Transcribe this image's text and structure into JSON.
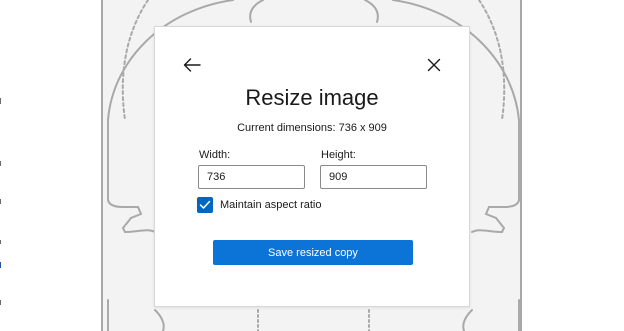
{
  "dialog": {
    "title": "Resize image",
    "current_dimensions": "Current dimensions: 736 x 909",
    "width_label": "Width:",
    "width_value": "736",
    "height_label": "Height:",
    "height_value": "909",
    "maintain_aspect_label": "Maintain aspect ratio",
    "maintain_aspect_checked": true,
    "save_label": "Save resized copy",
    "back_icon": "arrow-left-icon",
    "close_icon": "close-icon"
  },
  "colors": {
    "accent": "#0067c0",
    "primary_button": "#0b74d6",
    "canvas_background": "#f3f3f3",
    "sketch_stroke": "#a9a9a9"
  }
}
